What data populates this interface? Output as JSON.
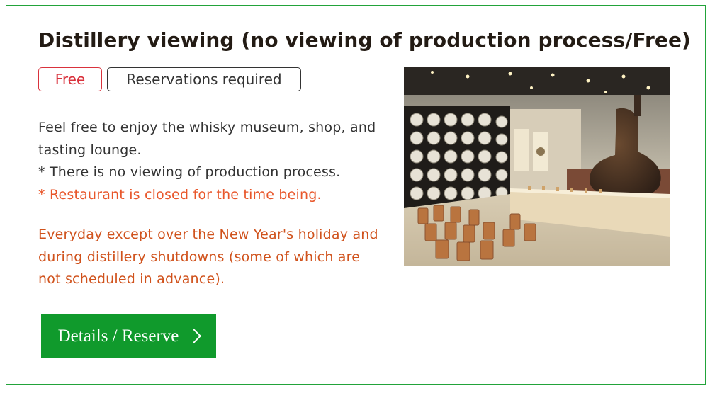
{
  "card": {
    "title": "Distillery viewing (no viewing of production process/Free)",
    "badges": {
      "free": "Free",
      "reservation": "Reservations required"
    },
    "description": {
      "line1": "Feel free to enjoy the whisky museum, shop, and tasting lounge.",
      "line2": "* There is no viewing of production process.",
      "line3": "* Restaurant is closed for the time being."
    },
    "schedule": "Everyday except over the New Year's holiday and during distillery shutdowns (some of which are not scheduled in advance).",
    "button_label": "Details / Reserve",
    "photo_subject": "whisky museum interior with barrel wall, wooden stools, counter and pot still",
    "colors": {
      "border": "#22a33a",
      "button": "#109a2c",
      "free_badge": "#d9323c",
      "note": "#e8562a",
      "schedule": "#d0521c"
    }
  }
}
